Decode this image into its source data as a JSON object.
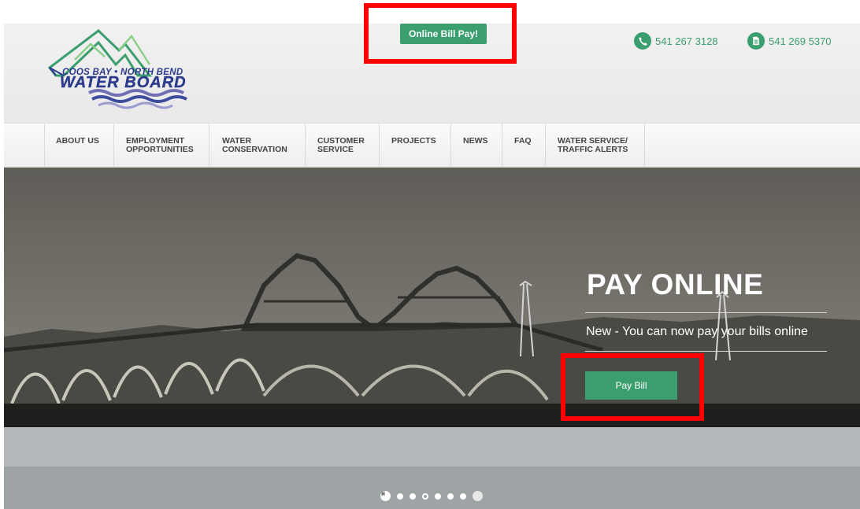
{
  "header": {
    "logo_line1": "COOS BAY • NORTH BEND",
    "logo_line2": "WATER BOARD",
    "online_bill_pay": "Online Bill Pay!",
    "phone": "541 267 3128",
    "fax": "541 269 5370"
  },
  "nav": {
    "items": [
      {
        "label": "ABOUT US"
      },
      {
        "label": "EMPLOYMENT\nOPPORTUNITIES"
      },
      {
        "label": "WATER\nCONSERVATION"
      },
      {
        "label": "CUSTOMER\nSERVICE"
      },
      {
        "label": "PROJECTS"
      },
      {
        "label": "NEWS"
      },
      {
        "label": "FAQ"
      },
      {
        "label": "WATER SERVICE/\nTRAFFIC ALERTS"
      }
    ]
  },
  "hero": {
    "title": "PAY ONLINE",
    "subtitle": "New - You can now pay your bills online",
    "button": "Pay Bill",
    "slides_total": 8,
    "slide_active": 3
  },
  "colors": {
    "brand_green": "#3a9e6e",
    "logo_blue": "#2c3b8c",
    "annotation_red": "#ff0000"
  },
  "icons": {
    "phone": "phone-icon",
    "fax": "document-icon"
  }
}
